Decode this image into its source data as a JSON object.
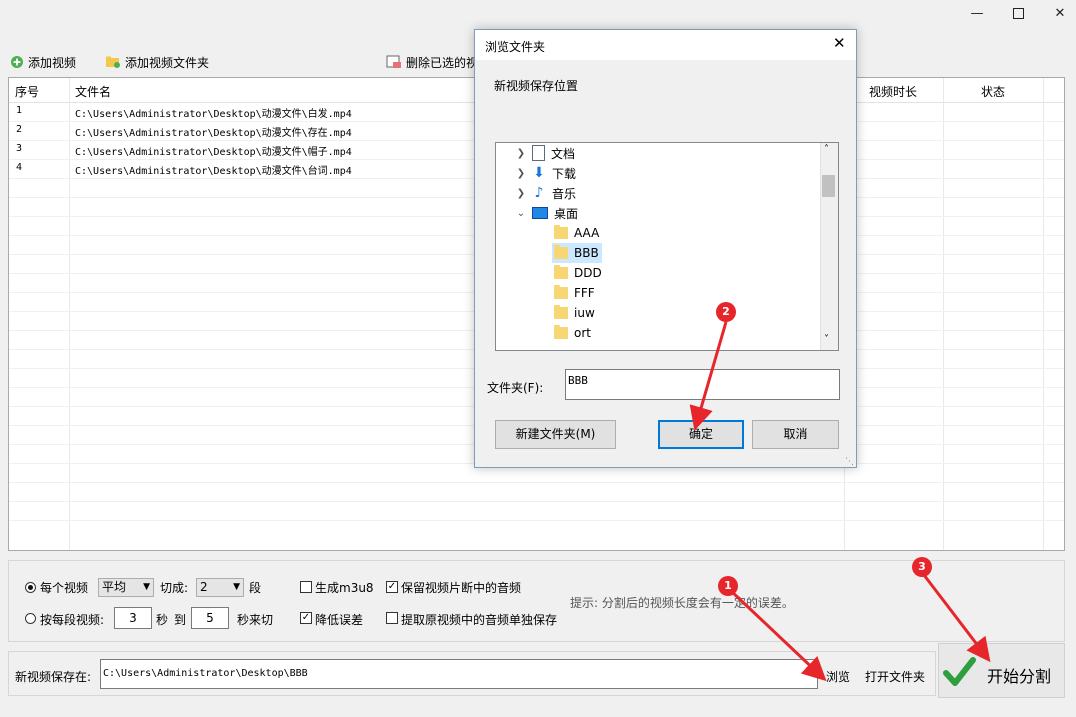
{
  "window": {
    "minimize_icon": "minimize-icon",
    "maximize_icon": "maximize-icon",
    "close_icon": "close-icon"
  },
  "toolbar": {
    "add_video": "添加视频",
    "add_folder": "添加视频文件夹",
    "delete_selected": "删除已选的视"
  },
  "list": {
    "columns": [
      "序号",
      "文件名",
      "视频时长",
      "状态"
    ],
    "rows": [
      {
        "index": "1",
        "file": "C:\\Users\\Administrator\\Desktop\\动漫文件\\白发.mp4"
      },
      {
        "index": "2",
        "file": "C:\\Users\\Administrator\\Desktop\\动漫文件\\存在.mp4"
      },
      {
        "index": "3",
        "file": "C:\\Users\\Administrator\\Desktop\\动漫文件\\帽子.mp4"
      },
      {
        "index": "4",
        "file": "C:\\Users\\Administrator\\Desktop\\动漫文件\\台词.mp4"
      }
    ]
  },
  "options": {
    "per_video": "每个视频",
    "mode_value": "平均",
    "cut_into": "切成:",
    "segments_value": "2",
    "segments_unit": "段",
    "gen_m3u8": "生成m3u8",
    "keep_audio": "保留视频片断中的音频",
    "per_segment": "按每段视频:",
    "from_value": "3",
    "sec": "秒",
    "to": "到",
    "to_value": "5",
    "sec_end": "秒来切",
    "reduce_error": "降低误差",
    "extract_audio": "提取原视频中的音频单独保存",
    "hint": "提示: 分割后的视频长度会有一定的误差。"
  },
  "save": {
    "label": "新视频保存在:",
    "path": "C:\\Users\\Administrator\\Desktop\\BBB",
    "browse": "浏览",
    "open_folder": "打开文件夹",
    "start": "开始分割"
  },
  "dialog": {
    "title": "浏览文件夹",
    "subtitle": "新视频保存位置",
    "tree": [
      {
        "label": "文档",
        "icon": "document-icon"
      },
      {
        "label": "下载",
        "icon": "download-arrow-icon"
      },
      {
        "label": "音乐",
        "icon": "music-note-icon"
      },
      {
        "label": "桌面",
        "icon": "desktop-icon"
      },
      {
        "label": "AAA"
      },
      {
        "label": "BBB"
      },
      {
        "label": "DDD"
      },
      {
        "label": "FFF"
      },
      {
        "label": "iuw"
      },
      {
        "label": "ort"
      }
    ],
    "folder_label": "文件夹(F):",
    "folder_value": "BBB",
    "new_folder": "新建文件夹(M)",
    "ok": "确定",
    "cancel": "取消"
  },
  "annotations": [
    "1",
    "2",
    "3"
  ],
  "colors": {
    "annotation": "#e6262a",
    "selected": "#cce8ff",
    "ok_border": "#0078d7"
  }
}
